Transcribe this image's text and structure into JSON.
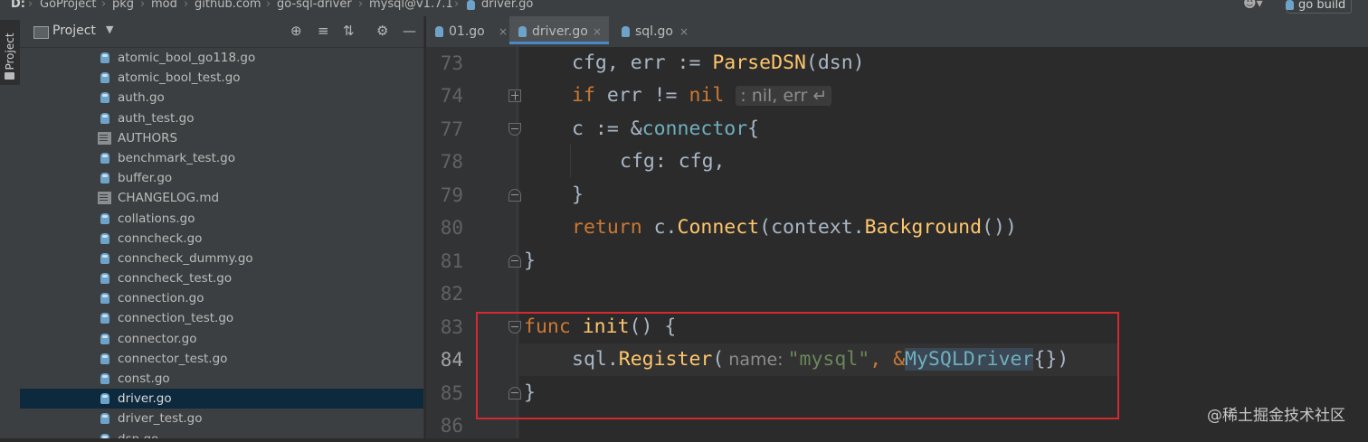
{
  "breadcrumb": {
    "drive": "D:",
    "items": [
      "GoProject",
      "pkg",
      "mod",
      "github.com",
      "go-sql-driver",
      "mysql@v1.7.1",
      "driver.go"
    ]
  },
  "toolbar": {
    "run_config": "go build",
    "user_icon": "person-icon"
  },
  "tool_strip": {
    "project_tab": "Project"
  },
  "project_panel": {
    "title": "Project",
    "tools": [
      "crosshair-icon",
      "expand-icon",
      "collapse-icon",
      "gear-icon",
      "minimize-icon"
    ],
    "files": [
      {
        "name": "atomic_bool_go118.go",
        "type": "go"
      },
      {
        "name": "atomic_bool_test.go",
        "type": "go"
      },
      {
        "name": "auth.go",
        "type": "go"
      },
      {
        "name": "auth_test.go",
        "type": "go"
      },
      {
        "name": "AUTHORS",
        "type": "text"
      },
      {
        "name": "benchmark_test.go",
        "type": "go"
      },
      {
        "name": "buffer.go",
        "type": "go"
      },
      {
        "name": "CHANGELOG.md",
        "type": "md"
      },
      {
        "name": "collations.go",
        "type": "go"
      },
      {
        "name": "conncheck.go",
        "type": "go"
      },
      {
        "name": "conncheck_dummy.go",
        "type": "go"
      },
      {
        "name": "conncheck_test.go",
        "type": "go"
      },
      {
        "name": "connection.go",
        "type": "go"
      },
      {
        "name": "connection_test.go",
        "type": "go"
      },
      {
        "name": "connector.go",
        "type": "go"
      },
      {
        "name": "connector_test.go",
        "type": "go"
      },
      {
        "name": "const.go",
        "type": "go"
      },
      {
        "name": "driver.go",
        "type": "go",
        "selected": true
      },
      {
        "name": "driver_test.go",
        "type": "go"
      },
      {
        "name": "dsn.go",
        "type": "go"
      }
    ]
  },
  "tabs": [
    {
      "label": "01.go",
      "close": "×"
    },
    {
      "label": "driver.go",
      "close": "×",
      "active": true
    },
    {
      "label": "sql.go",
      "close": "×"
    }
  ],
  "editor": {
    "line_numbers": [
      "73",
      "74",
      "77",
      "78",
      "79",
      "80",
      "81",
      "82",
      "83",
      "84",
      "85",
      "86"
    ],
    "tokens": {
      "l73_a": "cfg, err := ",
      "l73_fn": "ParseDSN",
      "l73_b": "(dsn)",
      "l74_if": "if",
      "l74_a": " err != ",
      "l74_nil": "nil",
      "l74_hint": ": nil, err ↵",
      "l77_a": "c := &",
      "l77_type": "connector",
      "l77_b": "{",
      "l78": "cfg: cfg,",
      "l79": "}",
      "l80_ret": "return",
      "l80_a": " c.",
      "l80_fn1": "Connect",
      "l80_b": "(context.",
      "l80_fn2": "Background",
      "l80_c": "())",
      "l81": "}",
      "l83_func": "func",
      "l83_name": "init",
      "l83_rest": "() {",
      "l84_a": "sql.",
      "l84_fn": "Register",
      "l84_b": "(",
      "l84_hint": "name:",
      "l84_str": "\"mysql\"",
      "l84_c": ", &",
      "l84_type": "MySQLDriver",
      "l84_d": "{})",
      "l85": "}"
    }
  },
  "watermark": "@稀土掘金技术社区",
  "colors": {
    "keyword": "#cc7832",
    "function": "#ffc66d",
    "string": "#6a8759",
    "type": "#6fafbd",
    "highlight_box": "#d5282f",
    "selection": "#0d293e"
  }
}
